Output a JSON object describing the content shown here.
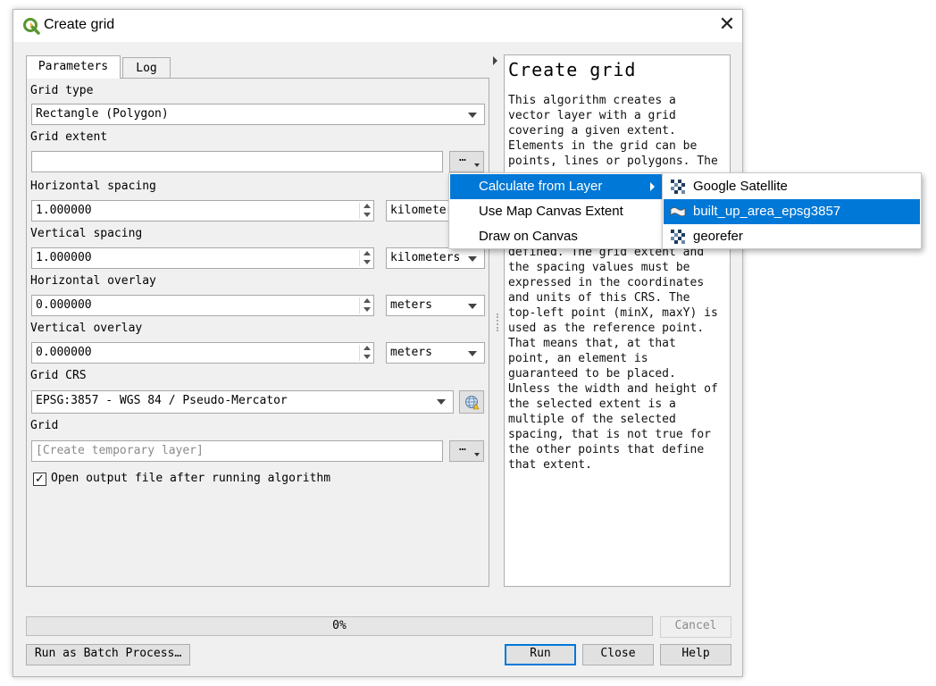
{
  "window": {
    "title": "Create grid",
    "close_glyph": "✕"
  },
  "tabs": [
    {
      "label": "Parameters"
    },
    {
      "label": "Log"
    }
  ],
  "params": {
    "grid_type_label": "Grid type",
    "grid_type_value": "Rectangle (Polygon)",
    "grid_extent_label": "Grid extent",
    "grid_extent_value": "",
    "dots": "…",
    "h_spacing_label": "Horizontal spacing",
    "h_spacing_value": "1.000000",
    "h_spacing_unit": "kilometers",
    "v_spacing_label": "Vertical spacing",
    "v_spacing_value": "1.000000",
    "v_spacing_unit": "kilometers",
    "h_overlay_label": "Horizontal overlay",
    "h_overlay_value": "0.000000",
    "h_overlay_unit": "meters",
    "v_overlay_label": "Vertical overlay",
    "v_overlay_value": "0.000000",
    "v_overlay_unit": "meters",
    "crs_label": "Grid CRS",
    "crs_value": "EPSG:3857 - WGS 84 / Pseudo-Mercator",
    "grid_label": "Grid",
    "grid_placeholder": "[Create temporary layer]",
    "open_output_label": "Open output file after running algorithm",
    "open_output_checked": "✓"
  },
  "help": {
    "title": "Create grid",
    "text_top": "This algorithm creates a\nvector layer with a grid\ncovering a given extent.\nElements in the grid can be\npoints, lines or polygons. The",
    "text_bottom": "defined. The grid extent and\nthe spacing values must be\nexpressed in the coordinates\nand units of this CRS. The\ntop-left point (minX, maxY) is\nused as the reference point.\nThat means that, at that\npoint, an element is\nguaranteed to be placed.\nUnless the width and height of\nthe selected extent is a\nmultiple of the selected\nspacing, that is not true for\nthe other points that define\nthat extent."
  },
  "progress": {
    "text": "0%",
    "value": 0
  },
  "buttons": {
    "cancel": "Cancel",
    "batch": "Run as Batch Process…",
    "run": "Run",
    "close": "Close",
    "help": "Help"
  },
  "context_menu": {
    "items": [
      {
        "label": "Calculate from Layer"
      },
      {
        "label": "Use Map Canvas Extent"
      },
      {
        "label": "Draw on Canvas"
      }
    ]
  },
  "submenu": {
    "items": [
      {
        "label": "Google Satellite",
        "icon": "raster-layer-icon"
      },
      {
        "label": "built_up_area_epsg3857",
        "icon": "vector-polygon-layer-icon"
      },
      {
        "label": "georefer",
        "icon": "raster-layer-icon"
      }
    ]
  },
  "colors": {
    "highlight": "#0078d7",
    "qgis_green": "#589632",
    "qgis_yellow": "#f0b321"
  }
}
